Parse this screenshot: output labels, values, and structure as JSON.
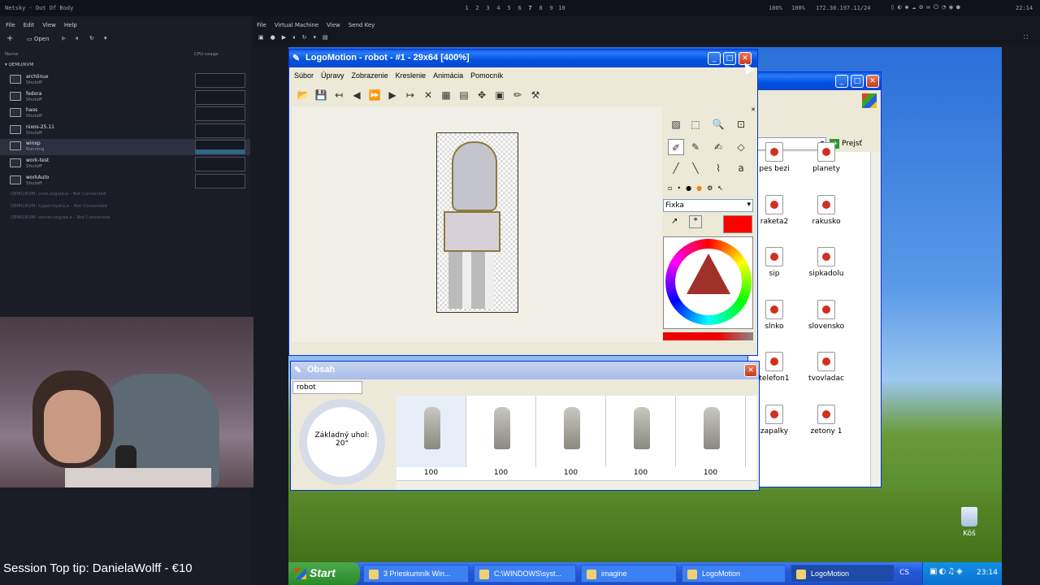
{
  "topbar": {
    "left": "Netsky - Out Of Body",
    "workspaces": [
      "1",
      "2",
      "3",
      "4",
      "5",
      "6",
      "7",
      "8",
      "9",
      "10"
    ],
    "right_pct1": "100%",
    "right_pct2": "100%",
    "ip": "172.30.197.11/24",
    "clock": "22:14"
  },
  "vmm": {
    "menu": [
      "File",
      "Edit",
      "View",
      "Help"
    ],
    "open": "Open",
    "col_name": "Name",
    "col_cpu": "CPU usage",
    "group": "QEMU/KVM",
    "vms": [
      {
        "name": "archlinux",
        "state": "Shutoff"
      },
      {
        "name": "fedora",
        "state": "Shutoff"
      },
      {
        "name": "haos",
        "state": "Shutoff"
      },
      {
        "name": "nixos-25.11",
        "state": "Shutoff"
      },
      {
        "name": "winxp",
        "state": "Running"
      },
      {
        "name": "work-test",
        "state": "Shutoff"
      },
      {
        "name": "workAuto",
        "state": "Shutoff"
      }
    ],
    "connections": [
      "QEMU/KVM: core.zoglab.e - Not Connected",
      "QEMU/KVM: hyper.hydra.e - Not Connected",
      "QEMU/KVM: server.zoglab.e - Not Connected"
    ]
  },
  "tip": "Session Top tip: DanielaWolff - €10",
  "vmwindow": {
    "menu": [
      "File",
      "Virtual Machine",
      "View",
      "Send Key"
    ]
  },
  "logomotion": {
    "title": "LogoMotion - robot - #1 - 29x64 [400%]",
    "menu": [
      "Súbor",
      "Úpravy",
      "Zobrazenie",
      "Kreslenie",
      "Animácia",
      "Pomocník"
    ],
    "pen": "Fixka",
    "accent": "#ff0000"
  },
  "obsah": {
    "title": "Obsah",
    "name": "robot",
    "dial_label": "Základný uhol:",
    "dial_value": "20°",
    "frames": [
      "100",
      "100",
      "100",
      "100",
      "100"
    ]
  },
  "explorer": {
    "go": "Prejsť",
    "files": [
      "pes bezi",
      "planety",
      "raketa2",
      "rakusko",
      "sip",
      "sipkadolu",
      "slnko",
      "slovensko",
      "telefon1",
      "tvovladac",
      "zapalky",
      "zetony 1"
    ]
  },
  "desktop": {
    "recycle": "Kôš"
  },
  "taskbar": {
    "start": "Start",
    "tasks": [
      "3 Prieskumník Win...",
      "C:\\WINDOWS\\syst...",
      "imagine",
      "LogoMotion",
      "LogoMotion"
    ],
    "lang": "CS",
    "clock": "23:14"
  }
}
